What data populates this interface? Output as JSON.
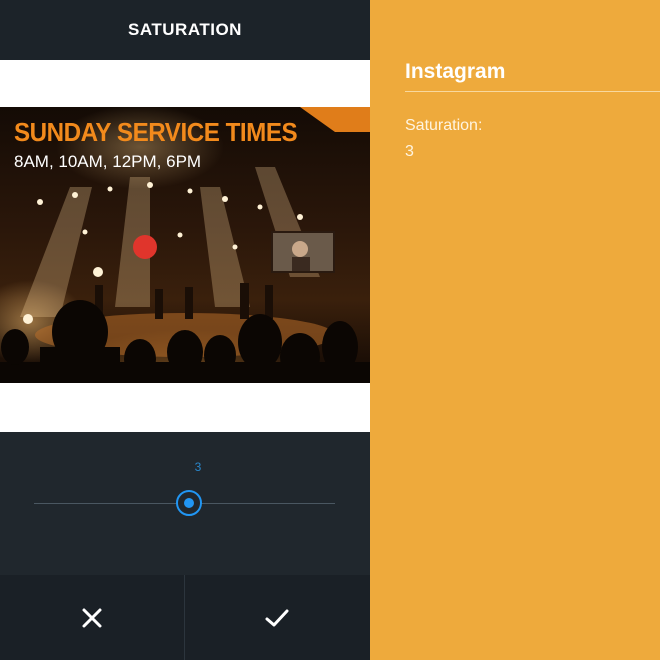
{
  "editor": {
    "title": "SATURATION",
    "photo": {
      "headline": "SUNDAY SERVICE TIMES",
      "times": "8AM, 10AM, 12PM, 6PM"
    },
    "slider": {
      "value_label": "3",
      "value": 3,
      "min": -100,
      "max": 100,
      "accent": "#2196f3"
    },
    "cancel_icon": "close-icon",
    "confirm_icon": "check-icon"
  },
  "info": {
    "app_name": "Instagram",
    "setting_label": "Saturation:",
    "setting_value": "3",
    "background": "#eeaa3c"
  }
}
